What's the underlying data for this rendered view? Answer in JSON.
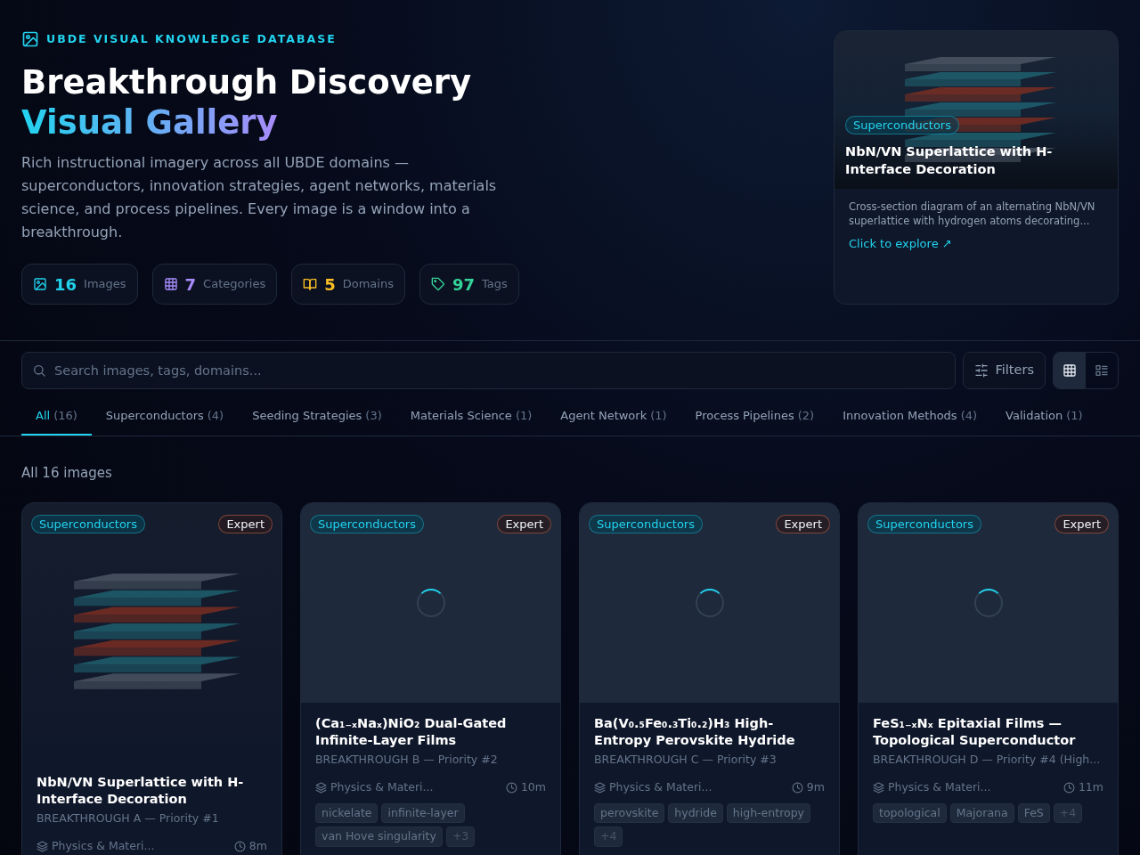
{
  "header": {
    "eyebrow": "UBDE VISUAL KNOWLEDGE DATABASE",
    "title": "Breakthrough Discovery",
    "title_accent": "Visual Gallery",
    "description": "Rich instructional imagery across all UBDE domains — superconductors, innovation strategies, agent networks, materials science, and process pipelines. Every image is a window into a breakthrough."
  },
  "stats": [
    {
      "kind": "images",
      "value": "16",
      "label": "Images",
      "color": "#22d3ee"
    },
    {
      "kind": "categories",
      "value": "7",
      "label": "Categories",
      "color": "#a78bfa"
    },
    {
      "kind": "domains",
      "value": "5",
      "label": "Domains",
      "color": "#fbbf24"
    },
    {
      "kind": "tags",
      "value": "97",
      "label": "Tags",
      "color": "#34d399"
    }
  ],
  "featured": {
    "category": "Superconductors",
    "title": "NbN/VN Superlattice with H-Interface Decoration",
    "description": "Cross-section diagram of an alternating NbN/VN superlattice with hydrogen atoms decorating...",
    "link": "Click to explore ↗"
  },
  "search": {
    "placeholder": "Search images, tags, domains..."
  },
  "filters_button": "Filters",
  "view_toggle": [
    {
      "kind": "grid",
      "selected": true
    },
    {
      "kind": "list",
      "selected": false
    }
  ],
  "tabs": [
    {
      "label": "All",
      "count": "(16)",
      "selected": true
    },
    {
      "label": "Superconductors",
      "count": "(4)",
      "selected": false
    },
    {
      "label": "Seeding Strategies",
      "count": "(3)",
      "selected": false
    },
    {
      "label": "Materials Science",
      "count": "(1)",
      "selected": false
    },
    {
      "label": "Agent Network",
      "count": "(1)",
      "selected": false
    },
    {
      "label": "Process Pipelines",
      "count": "(2)",
      "selected": false
    },
    {
      "label": "Innovation Methods",
      "count": "(4)",
      "selected": false
    },
    {
      "label": "Validation",
      "count": "(1)",
      "selected": false
    }
  ],
  "result_count": "All 16 images",
  "cards": [
    {
      "category": "Superconductors",
      "difficulty": "Expert",
      "image_loaded": true,
      "title": "NbN/VN Superlattice with H-Interface Decoration",
      "subtitle": "BREAKTHROUGH A — Priority #1",
      "domain": "Physics & Materi...",
      "time": "8m"
    },
    {
      "category": "Superconductors",
      "difficulty": "Expert",
      "image_loaded": false,
      "title": "(Ca₁₋ₓNaₓ)NiO₂ Dual-Gated Infinite-Layer Films",
      "subtitle": "BREAKTHROUGH B — Priority #2",
      "domain": "Physics & Materi...",
      "time": "10m",
      "tags": [
        "nickelate",
        "infinite-layer",
        "van Hove singularity"
      ],
      "more_tags": "+3"
    },
    {
      "category": "Superconductors",
      "difficulty": "Expert",
      "image_loaded": false,
      "title": "Ba(V₀.₅Fe₀.₃Ti₀.₂)H₃ High-Entropy Perovskite Hydride",
      "subtitle": "BREAKTHROUGH C — Priority #3",
      "domain": "Physics & Materi...",
      "time": "9m",
      "tags": [
        "perovskite",
        "hydride",
        "high-entropy"
      ],
      "more_tags": "+4"
    },
    {
      "category": "Superconductors",
      "difficulty": "Expert",
      "image_loaded": false,
      "title": "FeS₁₋ₓNₓ Epitaxial Films — Topological Superconductor",
      "subtitle": "BREAKTHROUGH D — Priority #4 (High...",
      "domain": "Physics & Materi...",
      "time": "11m",
      "tags": [
        "topological",
        "Majorana",
        "FeS"
      ],
      "more_tags": "+4"
    }
  ]
}
